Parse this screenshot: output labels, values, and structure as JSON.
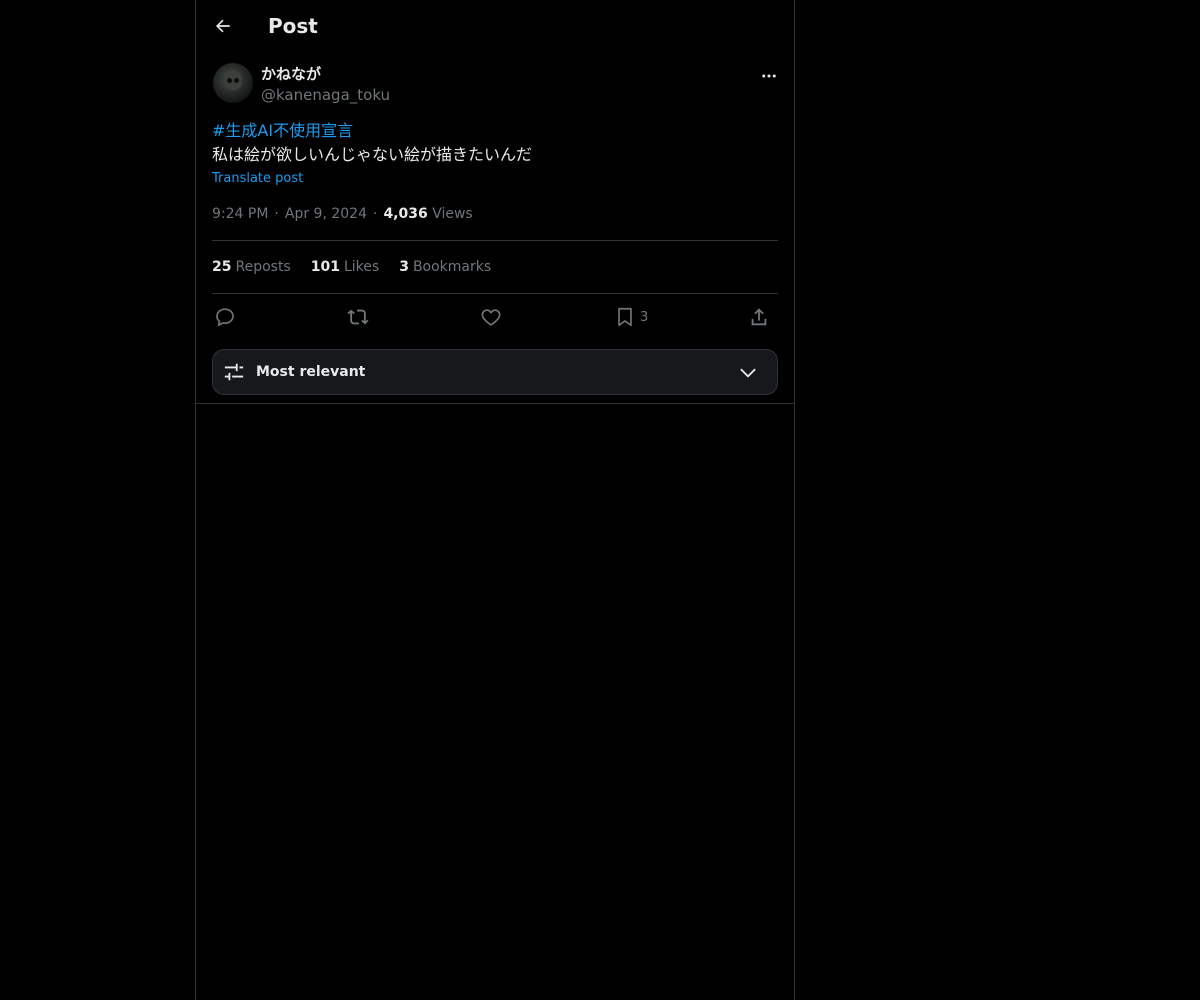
{
  "header": {
    "title": "Post",
    "back_icon": "arrow-left-icon"
  },
  "author": {
    "display_name": "かねなが",
    "handle": "@kanenaga_toku",
    "avatar_icon": "skull-avatar"
  },
  "post": {
    "hashtag": "#生成AI不使用宣言",
    "text": "私は絵が欲しいんじゃない絵が描きたいんだ",
    "translate_label": "Translate post",
    "time": "9:24 PM",
    "date": "Apr 9, 2024",
    "views_count": "4,036",
    "views_label": "Views"
  },
  "stats": {
    "reposts_count": "25",
    "reposts_label": "Reposts",
    "likes_count": "101",
    "likes_label": "Likes",
    "bookmarks_count": "3",
    "bookmarks_label": "Bookmarks"
  },
  "actions": {
    "reply_icon": "reply-icon",
    "repost_icon": "repost-icon",
    "like_icon": "heart-icon",
    "bookmark_icon": "bookmark-icon",
    "bookmark_count": "3",
    "share_icon": "share-icon"
  },
  "sort": {
    "label": "Most relevant"
  },
  "colors": {
    "background": "#000000",
    "text": "#e7e9ea",
    "secondary": "#71767b",
    "accent": "#1d9bf0",
    "border": "#2f3336"
  }
}
